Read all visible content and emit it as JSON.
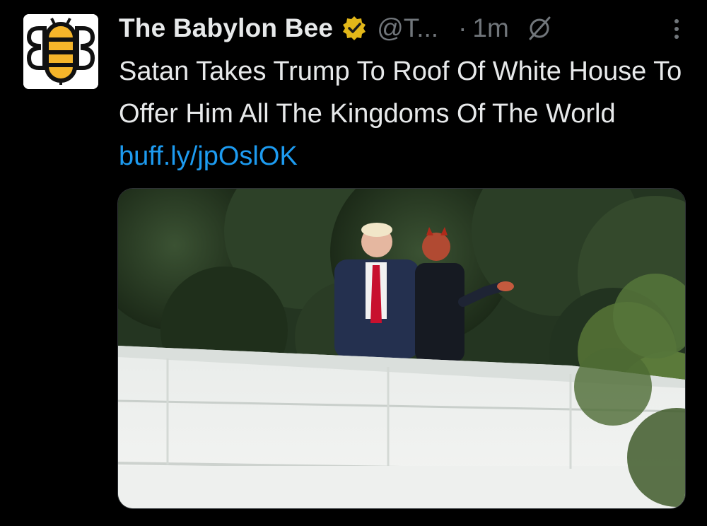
{
  "author": {
    "name": "The Babylon Bee",
    "handle": "@T...",
    "time_separator": "·",
    "time": "1m"
  },
  "tweet": {
    "text": "Satan Takes Trump To Roof Of White House To Offer Him All The Kingdoms Of The World",
    "link": "buff.ly/jpOslOK"
  },
  "colors": {
    "background": "#000000",
    "text": "#e7e9ea",
    "muted": "#71767b",
    "link": "#1d9bf0",
    "verified_gold": "#e2b719",
    "bee_yellow": "#f5b52a"
  },
  "icons": [
    "bee-logo-icon",
    "verified-badge-icon",
    "grok-icon",
    "more-options-icon"
  ]
}
